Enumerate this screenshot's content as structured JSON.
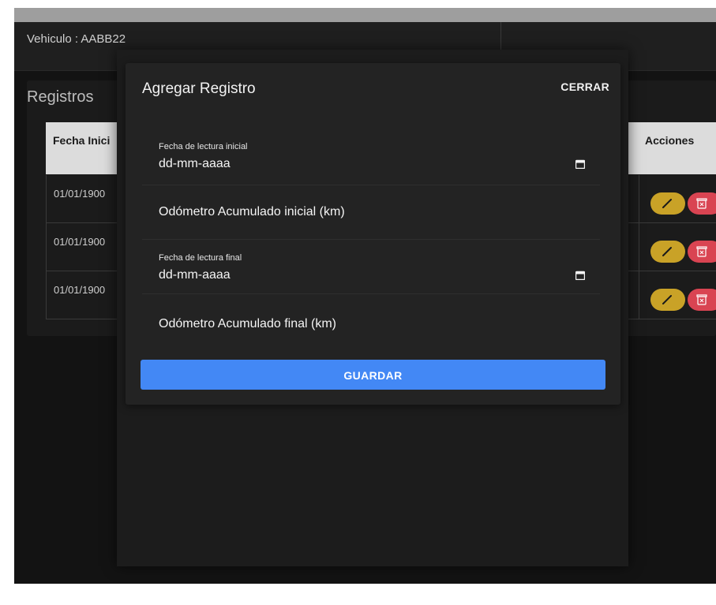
{
  "vehicle": {
    "label": "Vehiculo : AABB22"
  },
  "records": {
    "title": "Registros",
    "columns": {
      "start_date": "Fecha Inici",
      "actions": "Acciones"
    },
    "rows": [
      {
        "start_date": "01/01/1900"
      },
      {
        "start_date": "01/01/1900"
      },
      {
        "start_date": "01/01/1900"
      }
    ]
  },
  "modal": {
    "title": "Agregar Registro",
    "close_label": "CERRAR",
    "fields": [
      {
        "label": "Fecha de lectura inicial",
        "value": "dd-mm-aaaa"
      },
      {
        "placeholder": "Odómetro Acumulado inicial (km)"
      },
      {
        "label": "Fecha de lectura final",
        "value": "dd-mm-aaaa"
      },
      {
        "placeholder": "Odómetro Acumulado final (km)"
      }
    ],
    "save_label": "GUARDAR"
  },
  "icons": {
    "calendar": "calendar-icon",
    "edit": "pencil-icon",
    "delete": "trash-icon"
  },
  "colors": {
    "primary": "#4388f5",
    "edit": "#c9a227",
    "delete": "#d94452",
    "background": "#131313",
    "modal": "#232323"
  }
}
